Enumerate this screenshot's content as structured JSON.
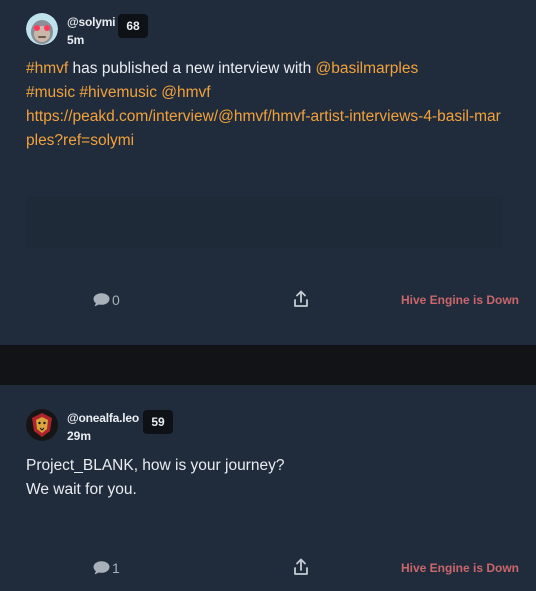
{
  "posts": [
    {
      "username": "@solymi",
      "reputation": "68",
      "time": "5m",
      "body_parts": {
        "t1": "#hmvf",
        "t2": " has published a new interview with ",
        "t3": "@basilmarples",
        "t4": "#music",
        "t5": " ",
        "t6": "#hivemusic",
        "t7": " ",
        "t8": "@hmvf",
        "t9": "https://peakd.com/interview/@hmvf/hmvf-artist-interviews-4-basil-marples?ref=solymi"
      },
      "comments": "0",
      "status": "Hive Engine is Down"
    },
    {
      "username": "@onealfa.leo",
      "reputation": "59",
      "time": "29m",
      "body_lines": [
        "Project_BLANK, how is your journey?",
        "We wait for you."
      ],
      "comments": "1",
      "status": "Hive Engine is Down"
    }
  ],
  "icons": {
    "avatar1": "avatar-ape-icon",
    "avatar2": "avatar-lion-icon",
    "comment": "comment-bubble-icon",
    "share": "share-icon"
  },
  "colors": {
    "accent": "#f2a23c",
    "status_error": "#c9676c",
    "card_bg": "#202b3b"
  }
}
